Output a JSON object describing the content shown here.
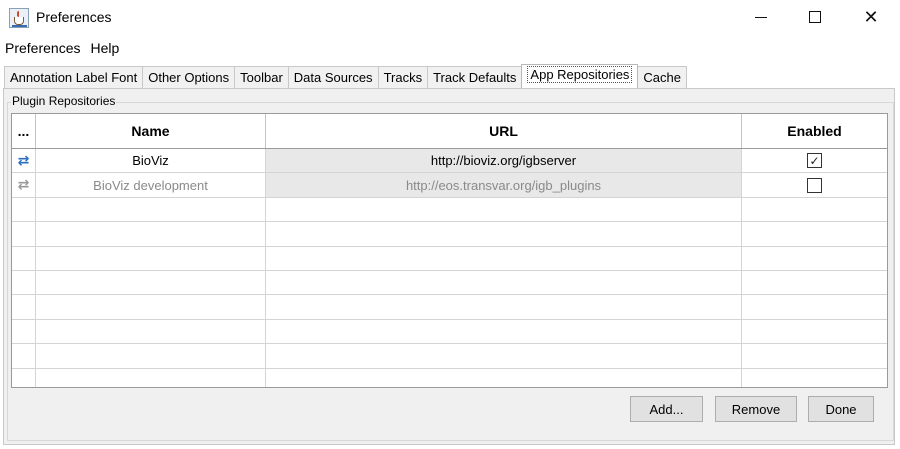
{
  "window": {
    "title": "Preferences",
    "icon": "java-cup-icon",
    "controls": {
      "minimize": "minimize-icon",
      "maximize": "maximize-icon",
      "close": "✕"
    }
  },
  "menu": {
    "items": [
      "Preferences",
      "Help"
    ]
  },
  "tabs": {
    "items": [
      "Annotation Label Font",
      "Other Options",
      "Toolbar",
      "Data Sources",
      "Tracks",
      "Track Defaults",
      "App Repositories",
      "Cache"
    ],
    "active": "App Repositories"
  },
  "group": {
    "title": "Plugin Repositories"
  },
  "table": {
    "columns": [
      "...",
      "Name",
      "URL",
      "Enabled"
    ],
    "rows": [
      {
        "icon": "⇄",
        "name": "BioViz",
        "url": "http://bioviz.org/igbserver",
        "enabled": true,
        "enabled_glyph": "✓"
      },
      {
        "icon": "⇄",
        "name": "BioViz development",
        "url": "http://eos.transvar.org/igb_plugins",
        "enabled": false,
        "enabled_glyph": ""
      }
    ],
    "empty_row_count": 8
  },
  "buttons": {
    "add": "Add...",
    "remove": "Remove",
    "done": "Done"
  },
  "colors": {
    "refresh_active": "#2d6fbf",
    "refresh_inactive": "#9a9a9a",
    "url_cell_bg": "#e8e8e8"
  }
}
